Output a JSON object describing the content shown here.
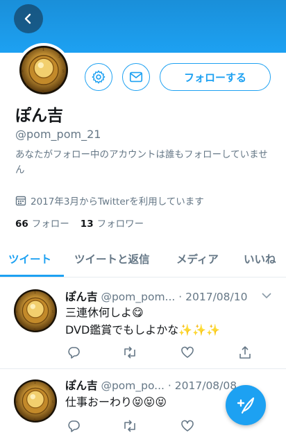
{
  "profile": {
    "name": "ぽん吉",
    "handle": "@pom_pom_21",
    "bio": "あなたがフォロー中のアカウントは誰もフォローしていません",
    "joined": "2017年3月からTwitterを利用しています",
    "following_count": "66",
    "following_label": "フォロー",
    "followers_count": "13",
    "followers_label": "フォロワー"
  },
  "actions": {
    "follow_label": "フォローする"
  },
  "tabs": [
    "ツイート",
    "ツイートと返信",
    "メディア",
    "いいね"
  ],
  "tweets": [
    {
      "name": "ぽん吉",
      "handle": "@pom_pom...",
      "sep": "·",
      "date": "2017/08/10",
      "line1": "三連休何しよ😋",
      "line2": "DVD鑑賞でもしよかな✨✨✨"
    },
    {
      "name": "ぽん吉",
      "handle": "@pom_po...",
      "sep": "·",
      "date": "2017/08/08",
      "line1": "仕事おーわり😝😝😝"
    }
  ],
  "colors": {
    "accent": "#1da1f2",
    "muted": "#657786",
    "text": "#14171a"
  },
  "icons": [
    "back-arrow-icon",
    "gear-icon",
    "mail-icon",
    "calendar-icon",
    "reply-icon",
    "retweet-icon",
    "like-icon",
    "share-icon",
    "chevron-down-icon",
    "compose-icon"
  ]
}
